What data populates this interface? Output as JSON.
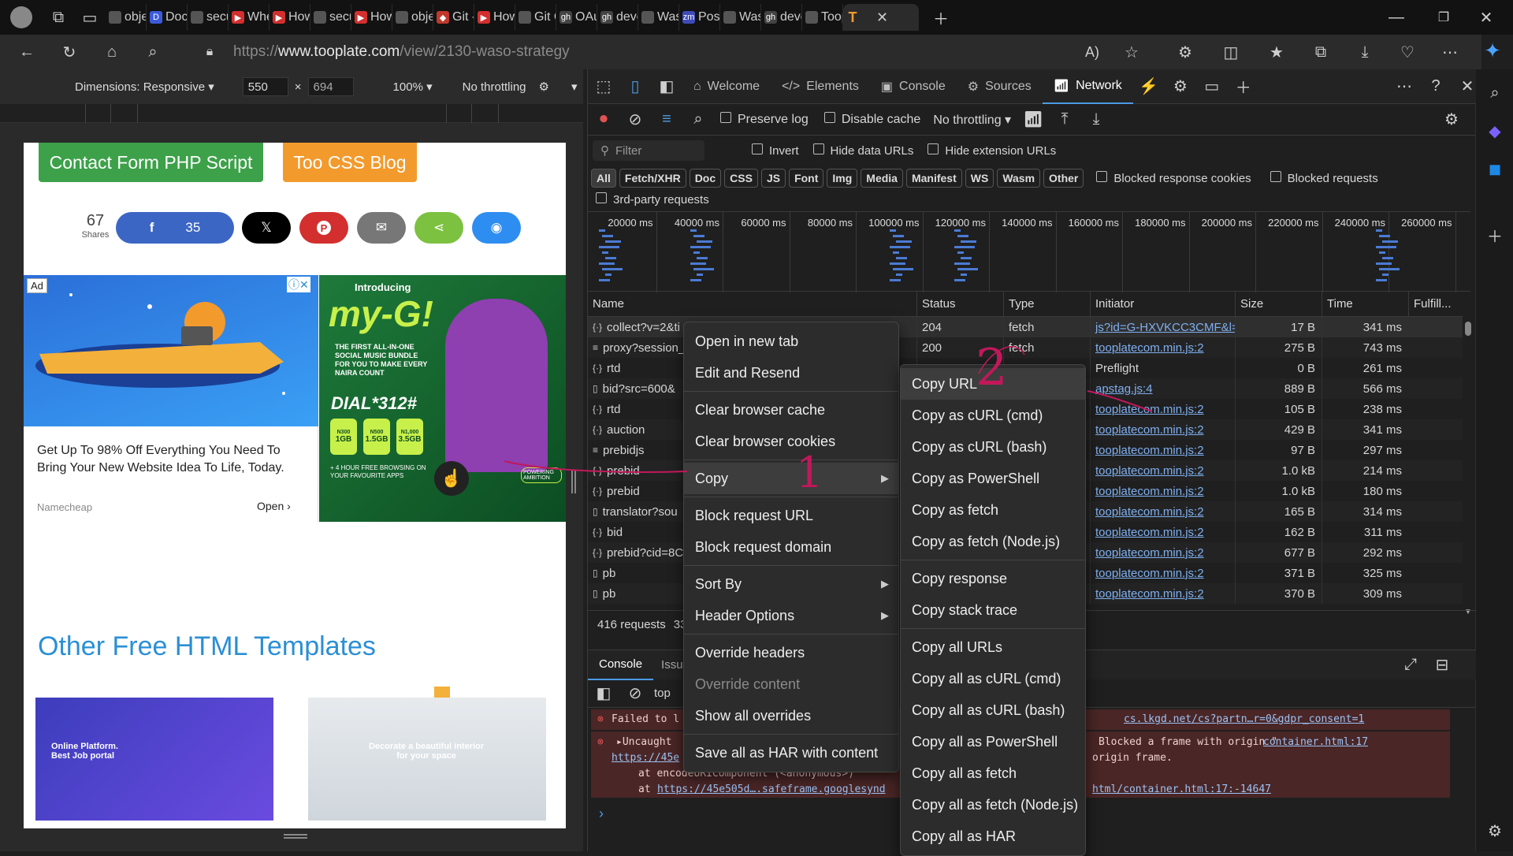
{
  "browser": {
    "tabs": [
      {
        "label": "obje",
        "fav": "doc",
        "color": "#555"
      },
      {
        "label": "Docs",
        "fav": "D",
        "color": "#3b5bdb"
      },
      {
        "label": "secu",
        "fav": "doc",
        "color": "#555"
      },
      {
        "label": "Whe",
        "fav": "▶",
        "color": "#d32f2f"
      },
      {
        "label": "How",
        "fav": "▶",
        "color": "#d32f2f"
      },
      {
        "label": "secu",
        "fav": "doc",
        "color": "#555"
      },
      {
        "label": "How",
        "fav": "▶",
        "color": "#d32f2f"
      },
      {
        "label": "obje",
        "fav": "doc",
        "color": "#555"
      },
      {
        "label": "Git -",
        "fav": "◆",
        "color": "#c0392b"
      },
      {
        "label": "How",
        "fav": "▶",
        "color": "#d32f2f"
      },
      {
        "label": "Git C",
        "fav": "doc",
        "color": "#555"
      },
      {
        "label": "OAu",
        "fav": "gh",
        "color": "#444"
      },
      {
        "label": "devc",
        "fav": "gh",
        "color": "#444"
      },
      {
        "label": "Was",
        "fav": "doc",
        "color": "#555"
      },
      {
        "label": "Post",
        "fav": "zm",
        "color": "#3e4bb8"
      },
      {
        "label": "Was",
        "fav": "doc",
        "color": "#555"
      },
      {
        "label": "devc",
        "fav": "gh",
        "color": "#444"
      },
      {
        "label": "Toop",
        "fav": "search",
        "color": "#555"
      }
    ],
    "active_tab": {
      "label": "T",
      "color": "#f39a2d"
    },
    "url_prefix": "https://",
    "url_host": "www.tooplate.com",
    "url_path": "/view/2130-waso-strategy"
  },
  "device_toolbar": {
    "dimensions_label": "Dimensions: Responsive",
    "width": "550",
    "height": "694",
    "times": "×",
    "zoom": "100%",
    "throttle": "No throttling"
  },
  "page": {
    "btn_contact": "Contact Form PHP Script",
    "btn_blog": "Too CSS Blog",
    "shares_count": "67",
    "shares_label": "Shares",
    "fb_count": "35",
    "ad_badge": "Ad",
    "ad_text": "Get Up To 98% Off Everything You Need To Bring Your New Website Idea To Life, Today.",
    "ad_brand": "Namecheap",
    "ad_open": "Open",
    "ad2_intro": "Introducing",
    "ad2_brand": "my-G!",
    "ad2_line": "THE FIRST ALL-IN-ONE SOCIAL MUSIC BUNDLE FOR YOU TO MAKE EVERY NAIRA COUNT",
    "ad2_dial": "DIAL*312#",
    "ad2_plans": [
      "1GB",
      "1.5GB",
      "3.5GB"
    ],
    "ad2_prices": [
      "N300",
      "N500",
      "N1,000"
    ],
    "ad2_foot": "+ 4 HOUR FREE BROWSING ON YOUR FAVOURITE APPS",
    "ad2_cta": "POWERING AMBITION",
    "other_heading": "Other Free HTML Templates",
    "thumb1_title": "Online Platform. Best Job portal",
    "thumb2_title": "Decorate a beautiful interior for your space"
  },
  "devtools": {
    "tabs": [
      "Welcome",
      "Elements",
      "Console",
      "Sources",
      "Network"
    ],
    "active": "Network",
    "preserve_log": "Preserve log",
    "disable_cache": "Disable cache",
    "throttle": "No throttling",
    "filter_placeholder": "Filter",
    "invert": "Invert",
    "hide_data": "Hide data URLs",
    "hide_ext": "Hide extension URLs",
    "types": [
      "All",
      "Fetch/XHR",
      "Doc",
      "CSS",
      "JS",
      "Font",
      "Img",
      "Media",
      "Manifest",
      "WS",
      "Wasm",
      "Other"
    ],
    "blocked_cookies": "Blocked response cookies",
    "blocked_requests": "Blocked requests",
    "third_party": "3rd-party requests",
    "timeline": [
      "20000 ms",
      "40000 ms",
      "60000 ms",
      "80000 ms",
      "100000 ms",
      "120000 ms",
      "140000 ms",
      "160000 ms",
      "180000 ms",
      "200000 ms",
      "220000 ms",
      "240000 ms",
      "260000 ms"
    ],
    "columns": [
      "Name",
      "Status",
      "Type",
      "Initiator",
      "Size",
      "Time",
      "Fulfill..."
    ],
    "rows": [
      {
        "icon": "{}",
        "name": "collect?v=2&ti",
        "status": "204",
        "type": "fetch",
        "initiator": "js?id=G-HXVKCC3CMF&l=d",
        "size": "17 B",
        "time": "341 ms"
      },
      {
        "icon": "doc",
        "name": "proxy?session_",
        "status": "200",
        "type": "fetch",
        "initiator": "tooplatecom.min.js:2",
        "size": "275 B",
        "time": "743 ms"
      },
      {
        "icon": "{}",
        "name": "rtd",
        "status": "",
        "type": "",
        "initiator": "Preflight",
        "size": "0 B",
        "time": "261 ms"
      },
      {
        "icon": "file",
        "name": "bid?src=600&",
        "status": "",
        "type": "",
        "initiator": "apstag.js:4",
        "size": "889 B",
        "time": "566 ms"
      },
      {
        "icon": "{}",
        "name": "rtd",
        "status": "",
        "type": "",
        "initiator": "tooplatecom.min.js:2",
        "size": "105 B",
        "time": "238 ms"
      },
      {
        "icon": "{}",
        "name": "auction",
        "status": "",
        "type": "",
        "initiator": "tooplatecom.min.js:2",
        "size": "429 B",
        "time": "341 ms"
      },
      {
        "icon": "doc",
        "name": "prebidjs",
        "status": "",
        "type": "",
        "initiator": "tooplatecom.min.js:2",
        "size": "97 B",
        "time": "297 ms"
      },
      {
        "icon": "{}",
        "name": "prebid",
        "status": "",
        "type": "",
        "initiator": "tooplatecom.min.js:2",
        "size": "1.0 kB",
        "time": "214 ms"
      },
      {
        "icon": "{}",
        "name": "prebid",
        "status": "",
        "type": "",
        "initiator": "tooplatecom.min.js:2",
        "size": "1.0 kB",
        "time": "180 ms"
      },
      {
        "icon": "file",
        "name": "translator?sou",
        "status": "",
        "type": "",
        "initiator": "tooplatecom.min.js:2",
        "size": "165 B",
        "time": "314 ms"
      },
      {
        "icon": "{}",
        "name": "bid",
        "status": "",
        "type": "",
        "initiator": "tooplatecom.min.js:2",
        "size": "162 B",
        "time": "311 ms"
      },
      {
        "icon": "{}",
        "name": "prebid?cid=8C",
        "status": "",
        "type": "",
        "initiator": "tooplatecom.min.js:2",
        "size": "677 B",
        "time": "292 ms"
      },
      {
        "icon": "file",
        "name": "pb",
        "status": "",
        "type": "",
        "initiator": "tooplatecom.min.js:2",
        "size": "371 B",
        "time": "325 ms"
      },
      {
        "icon": "file",
        "name": "pb",
        "status": "",
        "type": "",
        "initiator": "tooplatecom.min.js:2",
        "size": "370 B",
        "time": "309 ms"
      }
    ],
    "summary": "416 requests",
    "summary_tail": "33",
    "drawer_tabs": [
      "Console",
      "Issu"
    ],
    "context": "top",
    "console_lines": [
      {
        "text": "Failed to l",
        "right": "cs.lkgd.net/cs?partn…r=0&gdpr_consent=1"
      },
      {
        "text": "▸Uncaught",
        "right": "Blocked a frame with origin \"",
        "right_link": "container.html:17"
      }
    ],
    "console_line2b": "https://45e",
    "console_right2b": "origin frame.",
    "console_at1": "at encodeURIComponent (<anonymous>)",
    "console_at2_prefix": "at ",
    "console_at2_link": "https://45e505d….safeframe.googlesynd",
    "console_at2_right": "html/container.html:17:-14647",
    "prompt": "›"
  },
  "context_menu": {
    "items": [
      {
        "label": "Open in new tab",
        "sub": false
      },
      {
        "label": "Edit and Resend",
        "sub": false
      },
      {
        "sep": true
      },
      {
        "label": "Clear browser cache",
        "sub": false
      },
      {
        "label": "Clear browser cookies",
        "sub": false
      },
      {
        "sep": true
      },
      {
        "label": "Copy",
        "sub": true,
        "hl": true
      },
      {
        "sep": true
      },
      {
        "label": "Block request URL",
        "sub": false
      },
      {
        "label": "Block request domain",
        "sub": false
      },
      {
        "sep": true
      },
      {
        "label": "Sort By",
        "sub": true
      },
      {
        "label": "Header Options",
        "sub": true
      },
      {
        "sep": true
      },
      {
        "label": "Override headers",
        "sub": false
      },
      {
        "label": "Override content",
        "sub": false,
        "disabled": true
      },
      {
        "label": "Show all overrides",
        "sub": false
      },
      {
        "sep": true
      },
      {
        "label": "Save all as HAR with content",
        "sub": false
      }
    ]
  },
  "copy_submenu": {
    "items": [
      {
        "label": "Copy URL",
        "hl": true
      },
      {
        "label": "Copy as cURL (cmd)"
      },
      {
        "label": "Copy as cURL (bash)"
      },
      {
        "label": "Copy as PowerShell"
      },
      {
        "label": "Copy as fetch"
      },
      {
        "label": "Copy as fetch (Node.js)"
      },
      {
        "sep": true
      },
      {
        "label": "Copy response"
      },
      {
        "label": "Copy stack trace"
      },
      {
        "sep": true
      },
      {
        "label": "Copy all URLs"
      },
      {
        "label": "Copy all as cURL (cmd)"
      },
      {
        "label": "Copy all as cURL (bash)"
      },
      {
        "label": "Copy all as PowerShell"
      },
      {
        "label": "Copy all as fetch"
      },
      {
        "label": "Copy all as fetch (Node.js)"
      },
      {
        "label": "Copy all as HAR"
      }
    ]
  },
  "annotations": {
    "one": "1",
    "two": "2"
  },
  "colors": {
    "accent": "#4b9be6",
    "link": "#7fb0f0",
    "annotation": "#c2185b"
  }
}
